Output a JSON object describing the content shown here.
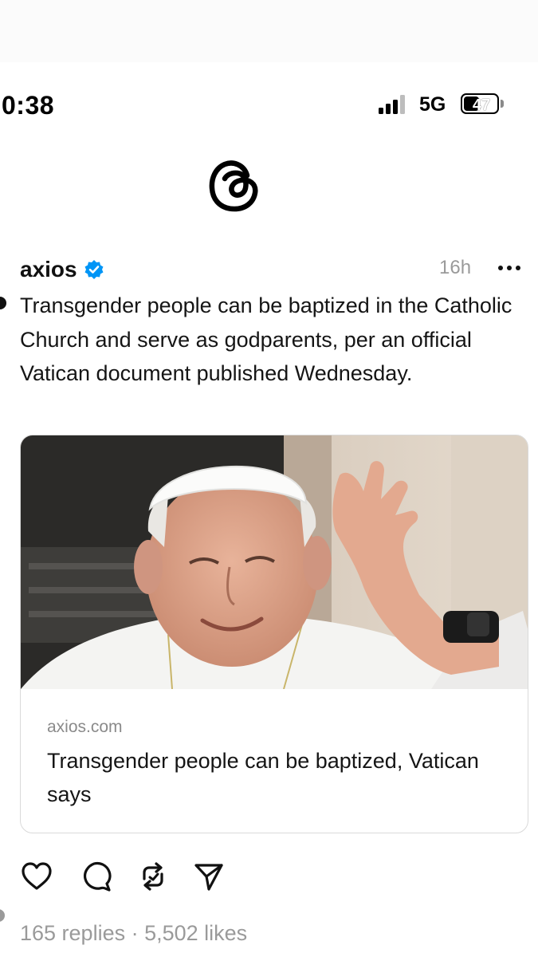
{
  "status_bar": {
    "time": "0:38",
    "network": "5G",
    "battery_level": "47",
    "battery_fraction": 0.47
  },
  "app": {
    "logo_icon": "threads-logo-icon"
  },
  "post": {
    "username": "axios",
    "verified": true,
    "timestamp": "16h",
    "more_icon": "more-horizontal-icon",
    "text": "Transgender people can be baptized in the Catholic Church and serve as godparents, per an official Vatican document published Wednesday.",
    "link_card": {
      "domain": "axios.com",
      "title": "Transgender people can be baptized, Vatican says",
      "image_icon": "pope-photo"
    },
    "actions": [
      {
        "name": "like-icon"
      },
      {
        "name": "reply-icon"
      },
      {
        "name": "repost-icon"
      },
      {
        "name": "share-icon"
      }
    ],
    "stats": {
      "text": "165 replies · 5,502 likes"
    }
  },
  "colors": {
    "verified_blue": "#0095f6",
    "muted_gray": "#9a9a9a",
    "text": "#151515",
    "card_border": "#d9d9d9"
  }
}
